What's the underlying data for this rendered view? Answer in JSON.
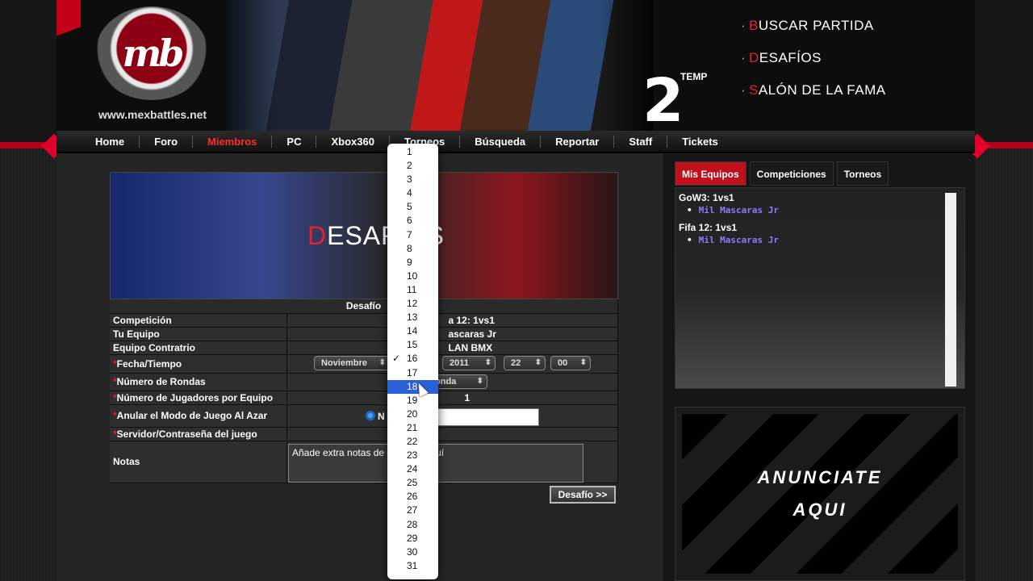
{
  "site": {
    "url": "www.mexbattles.net",
    "logo_text": "mb",
    "season_number": "2",
    "season_word": "TEMP"
  },
  "header_menu": [
    "BUSCAR PARTIDA",
    "DESAFÍOS",
    "SALÓN DE LA FAMA"
  ],
  "nav": [
    "Home",
    "Foro",
    "Miembros",
    "PC",
    "Xbox360",
    "Torneos",
    "Búsqueda",
    "Reportar",
    "Staff",
    "Tickets"
  ],
  "nav_active": "Miembros",
  "hero_title": "DESAFÍOS",
  "form": {
    "caption": "Desafío",
    "rows": [
      {
        "label": "Competición",
        "value": "a 12: 1vs1"
      },
      {
        "label": "Tu Equipo",
        "value": "ascaras Jr"
      },
      {
        "label": "Equipo Contratrio",
        "value": "LAN BMX"
      }
    ],
    "fecha_label": "Fecha/Tiempo",
    "month": "Noviembre",
    "year": "2011",
    "hour": "22",
    "minute": "00",
    "rondas_label": "Número de Rondas",
    "rondas_value": "onda",
    "jugadores_label": "Número de Jugadores por Equipo",
    "jugadores_value": "1",
    "anular_label": "Anular el Modo de Juego Al Azar",
    "anular_radio": "N",
    "servidor_label": "Servidor/Contraseña del juego",
    "notas_label": "Notas",
    "notas_value": "Añade extra notas de",
    "notas_tail": "uí",
    "submit": "Desafío >>"
  },
  "right_tabs": [
    "Mis Equipos",
    "Competiciones",
    "Torneos"
  ],
  "teams": [
    {
      "competition": "GoW3: 1vs1",
      "team": "Mil Mascaras Jr"
    },
    {
      "competition": "Fifa 12: 1vs1",
      "team": "Mil Mascaras Jr"
    }
  ],
  "ad": {
    "line1": "ANUNCIATE",
    "line2": "AQUI"
  },
  "day_dropdown": {
    "options": [
      "1",
      "2",
      "3",
      "4",
      "5",
      "6",
      "7",
      "8",
      "9",
      "10",
      "11",
      "12",
      "13",
      "14",
      "15",
      "16",
      "17",
      "18",
      "19",
      "20",
      "21",
      "22",
      "23",
      "24",
      "25",
      "26",
      "27",
      "28",
      "29",
      "30",
      "31"
    ],
    "checked": "16",
    "highlighted": "18"
  },
  "colors": {
    "accent": "#e8202a",
    "tab_active": "#c0101c",
    "team_link": "#8a7cff",
    "highlight": "#2b5fd6"
  }
}
